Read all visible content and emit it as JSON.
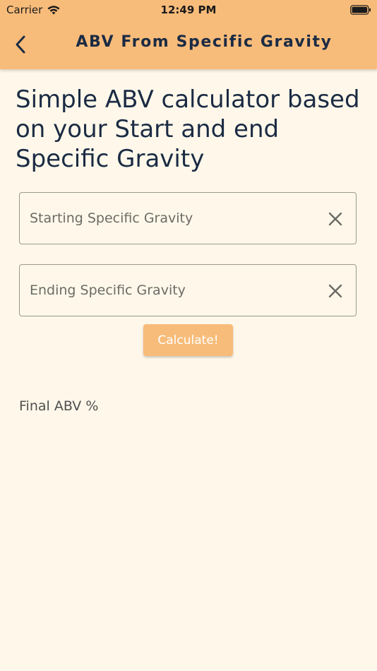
{
  "status_bar": {
    "carrier": "Carrier",
    "time": "12:49 PM"
  },
  "nav": {
    "title": "ABV From Specific Gravity",
    "back_icon": "chevron-left-icon"
  },
  "main": {
    "headline": "Simple ABV calculator based on your Start and end Specific Gravity",
    "start_field": {
      "placeholder": "Starting Specific Gravity",
      "value": ""
    },
    "end_field": {
      "placeholder": "Ending Specific Gravity",
      "value": ""
    },
    "calculate_label": "Calculate!",
    "result_label": "Final ABV %"
  },
  "colors": {
    "header_bg": "#F8BC7A",
    "page_bg": "#FFF8EA",
    "text_primary": "#1B2B44",
    "button_bg": "#F8BC7A",
    "button_text": "#FFFFFF"
  }
}
